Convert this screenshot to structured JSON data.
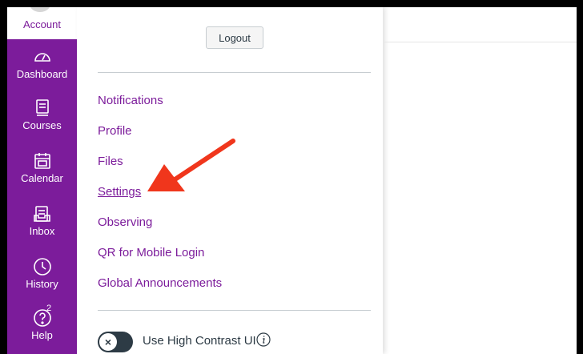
{
  "nav": {
    "account_label": "Account",
    "items": [
      {
        "label": "Dashboard",
        "icon": "dashboard-icon"
      },
      {
        "label": "Courses",
        "icon": "courses-icon"
      },
      {
        "label": "Calendar",
        "icon": "calendar-icon"
      },
      {
        "label": "Inbox",
        "icon": "inbox-icon"
      },
      {
        "label": "History",
        "icon": "history-icon"
      },
      {
        "label": "Help",
        "icon": "help-icon",
        "badge": "2"
      }
    ],
    "color": "#7c1c9b"
  },
  "tray": {
    "logout_label": "Logout",
    "links": [
      {
        "label": "Notifications"
      },
      {
        "label": "Profile"
      },
      {
        "label": "Files"
      },
      {
        "label": "Settings"
      },
      {
        "label": "Observing"
      },
      {
        "label": "QR for Mobile Login"
      },
      {
        "label": "Global Announcements"
      }
    ],
    "high_contrast": {
      "label": "Use High Contrast UI",
      "toggle_glyph": "×",
      "enabled": false
    }
  },
  "annotation": {
    "arrow_color": "#f0361c"
  }
}
